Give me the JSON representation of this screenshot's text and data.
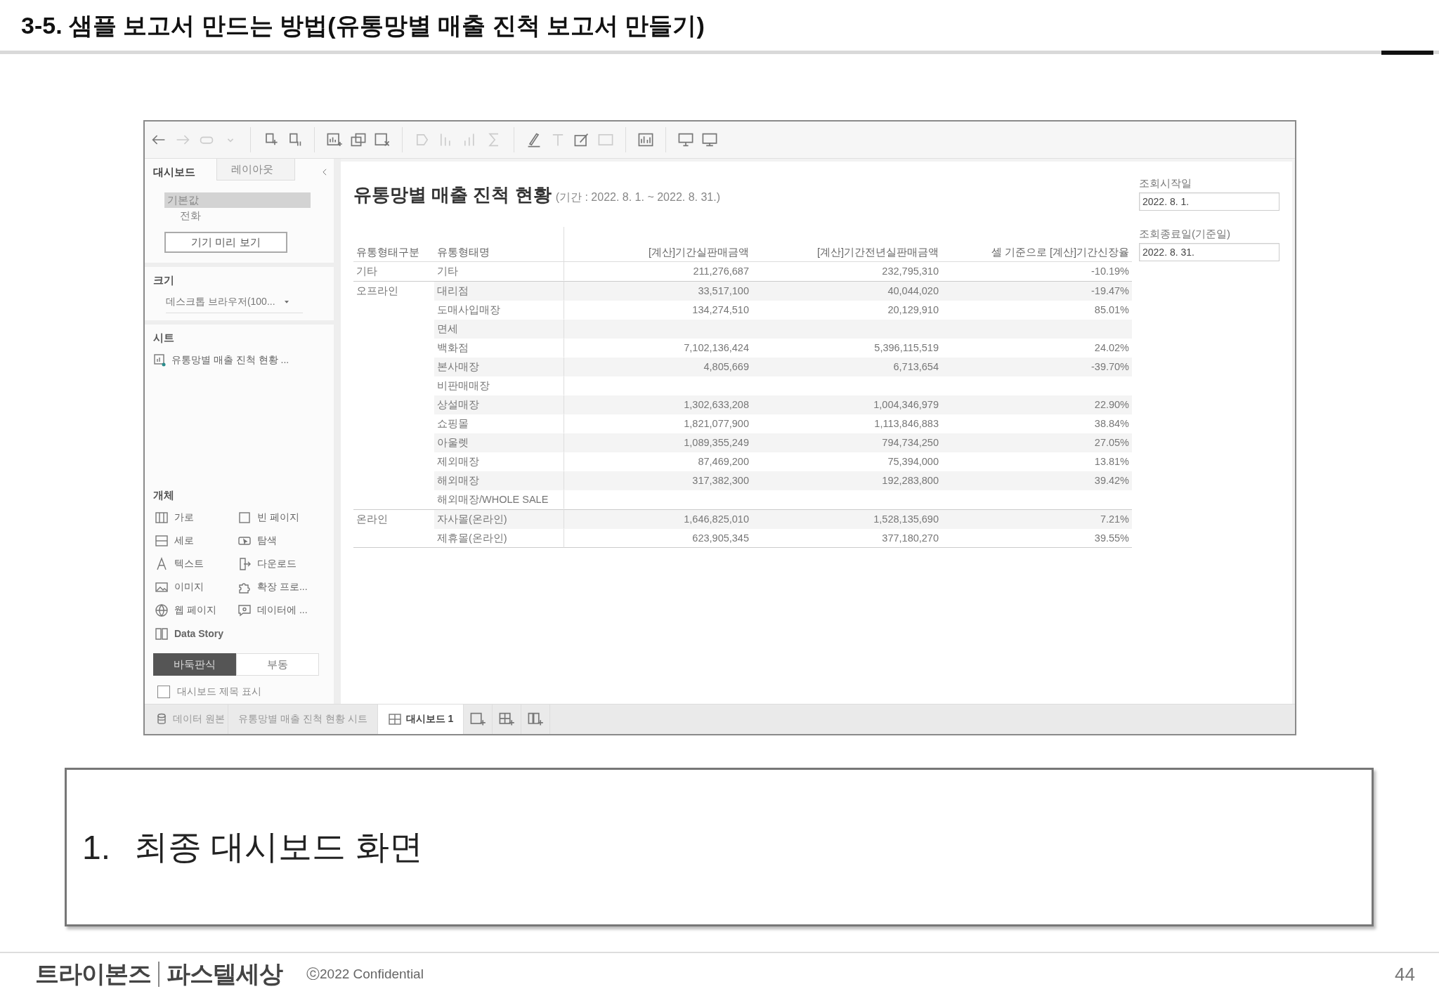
{
  "slide": {
    "title": "3-5. 샘플 보고서 만드는 방법(유통망별 매출 진척 보고서 만들기)"
  },
  "app": {
    "left_panel": {
      "tabs": [
        {
          "label": "대시보드",
          "selected": true
        },
        {
          "label": "레이아웃",
          "selected": false
        }
      ],
      "devices": [
        {
          "label": "기본값",
          "selected": true
        },
        {
          "label": "전화",
          "selected": false
        }
      ],
      "preview_button": "기기 미리 보기",
      "size_title": "크기",
      "size_value": "데스크톱 브라우저(100...",
      "sheets_title": "시트",
      "sheets": [
        "유통망별 매출 진척 현황 ..."
      ],
      "objects_title": "개체",
      "objects": [
        {
          "kind": "horizontal",
          "label": "가로"
        },
        {
          "kind": "blank",
          "label": "빈 페이지"
        },
        {
          "kind": "vertical",
          "label": "세로"
        },
        {
          "kind": "navigation",
          "label": "탐색"
        },
        {
          "kind": "text",
          "label": "텍스트"
        },
        {
          "kind": "download",
          "label": "다운로드"
        },
        {
          "kind": "image",
          "label": "이미지"
        },
        {
          "kind": "extension",
          "label": "확장 프로..."
        },
        {
          "kind": "webpage",
          "label": "웹 페이지"
        },
        {
          "kind": "askdata",
          "label": "데이터에 ..."
        },
        {
          "kind": "story",
          "label": "Data Story"
        }
      ],
      "layout_modes": [
        {
          "label": "바둑판식",
          "selected": true
        },
        {
          "label": "부동",
          "selected": false
        }
      ],
      "show_title": {
        "label": "대시보드 제목 표시",
        "checked": false
      }
    },
    "dashboard": {
      "title": "유통망별 매출 진척 현황",
      "period": "(기간 : 2022. 8. 1. ~ 2022. 8. 31.)",
      "columns": [
        "유통형태구분",
        "유통형태명",
        "[계산]기간실판매금액",
        "[계산]기간전년실판매금액",
        "셀 기준으로 [계산]기간신장율"
      ],
      "rows": [
        {
          "group": "기타",
          "name": "기타",
          "values": [
            "211,276,687",
            "232,795,310",
            "-10.19%"
          ]
        },
        {
          "group": "오프라인",
          "name": "대리점",
          "values": [
            "33,517,100",
            "40,044,020",
            "-19.47%"
          ]
        },
        {
          "name": "도매사입매장",
          "values": [
            "134,274,510",
            "20,129,910",
            "85.01%"
          ]
        },
        {
          "name": "면세"
        },
        {
          "name": "백화점",
          "values": [
            "7,102,136,424",
            "5,396,115,519",
            "24.02%"
          ]
        },
        {
          "name": "본사매장",
          "values": [
            "4,805,669",
            "6,713,654",
            "-39.70%"
          ]
        },
        {
          "name": "비판매매장"
        },
        {
          "name": "상설매장",
          "values": [
            "1,302,633,208",
            "1,004,346,979",
            "22.90%"
          ]
        },
        {
          "name": "쇼핑몰",
          "values": [
            "1,821,077,900",
            "1,113,846,883",
            "38.84%"
          ]
        },
        {
          "name": "아울렛",
          "values": [
            "1,089,355,249",
            "794,734,250",
            "27.05%"
          ]
        },
        {
          "name": "제외매장",
          "values": [
            "87,469,200",
            "75,394,000",
            "13.81%"
          ]
        },
        {
          "name": "해외매장",
          "values": [
            "317,382,300",
            "192,283,800",
            "39.42%"
          ]
        },
        {
          "name": "해외매장/WHOLE SALE"
        },
        {
          "group": "온라인",
          "name": "자사몰(온라인)",
          "values": [
            "1,646,825,010",
            "1,528,135,690",
            "7.21%"
          ]
        },
        {
          "name": "제휴몰(온라인)",
          "values": [
            "623,905,345",
            "377,180,270",
            "39.55%"
          ]
        }
      ],
      "filters": [
        {
          "label": "조회시작일",
          "value": "2022. 8. 1."
        },
        {
          "label": "조회종료일(기준일)",
          "value": "2022. 8. 31."
        }
      ]
    },
    "bottom_tabs": [
      {
        "kind": "datasource",
        "label": "데이터 원본",
        "selected": false
      },
      {
        "kind": "sheet",
        "label": "유통망별 매출 진척 현황 시트",
        "selected": false
      },
      {
        "kind": "dashboard",
        "label": "대시보드 1",
        "selected": true
      }
    ]
  },
  "caption": {
    "number": "1.",
    "text": "최종 대시보드 화면"
  },
  "footer": {
    "logo_left": "트라이본즈",
    "logo_right": "파스텔세상",
    "copyright": "ⓒ2022 Confidential",
    "page": "44"
  }
}
